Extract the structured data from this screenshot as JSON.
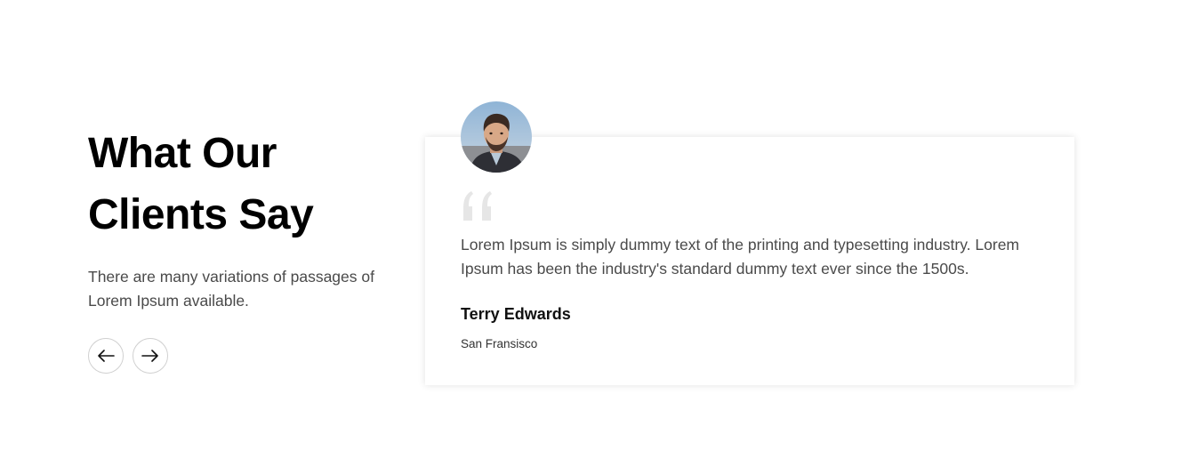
{
  "section": {
    "heading_line1": "What Our",
    "heading_line2": "Clients Say",
    "subtext": "There are many variations of passages of Lorem Ipsum available."
  },
  "navigation": {
    "prev_icon": "arrow-left-icon",
    "next_icon": "arrow-right-icon"
  },
  "testimonial": {
    "quote_icon": "quote-icon",
    "text": "Lorem Ipsum is simply dummy text of the printing and typesetting industry. Lorem Ipsum has been the industry's standard dummy text ever since the 1500s.",
    "name": "Terry Edwards",
    "location": "San Fransisco"
  },
  "colors": {
    "heading": "#000000",
    "body_text": "#4a4a4a",
    "quote_mark": "#e6e6e6",
    "nav_border": "#d0d0d0"
  }
}
